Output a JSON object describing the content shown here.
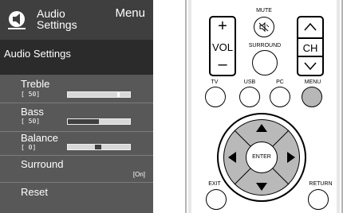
{
  "tv_menu": {
    "header_title_line1": "Audio",
    "header_title_line2": "Settings",
    "header_menu_label": "Menu",
    "section_title": "Audio Settings",
    "rows": [
      {
        "label": "Treble",
        "value": "[ 50]",
        "level": 0.5
      },
      {
        "label": "Bass",
        "value": "[ 50]",
        "level": 0.5
      },
      {
        "label": "Balance",
        "value": "[  0]",
        "level": 0.5
      },
      {
        "label": "Surround",
        "value": "[On]"
      },
      {
        "label": "Reset"
      }
    ]
  },
  "remote": {
    "mute_label": "MUTE",
    "vol_plus": "+",
    "vol_label": "VOL",
    "vol_minus": "–",
    "surround_label": "SURROUND",
    "ch_label": "CH",
    "tv_label": "TV",
    "usb_label": "USB",
    "pc_label": "PC",
    "menu_label": "MENU",
    "enter_label": "ENTER",
    "exit_label": "EXIT",
    "return_label": "RETURN"
  },
  "colors": {
    "menu_panel": "#585858",
    "menu_header": "#3f3f3f",
    "menu_section": "#2b2b2b",
    "highlight_button": "#b7b7b7",
    "dpad_ring": "#b9b9b9"
  }
}
